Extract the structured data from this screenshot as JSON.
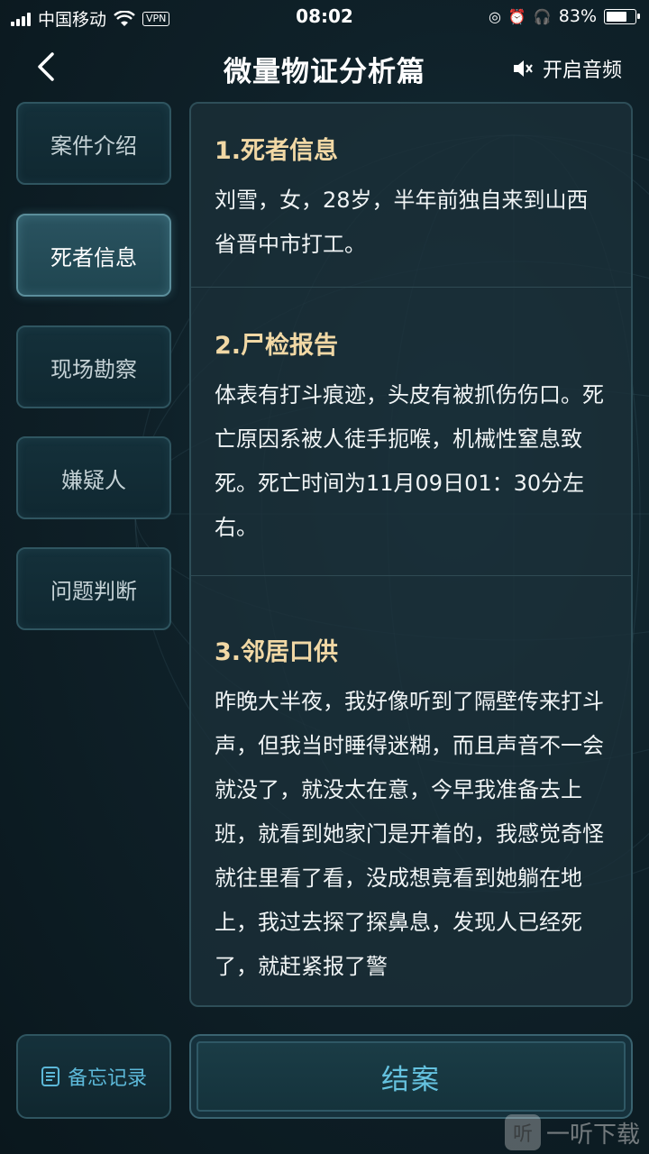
{
  "status_bar": {
    "carrier": "中国移动",
    "vpn": "VPN",
    "time": "08:02",
    "battery": "83%",
    "battery_level": 0.83
  },
  "header": {
    "title": "微量物证分析篇",
    "audio_label": "开启音频"
  },
  "sidebar": {
    "items": [
      {
        "label": "案件介绍",
        "active": false
      },
      {
        "label": "死者信息",
        "active": true
      },
      {
        "label": "现场勘察",
        "active": false
      },
      {
        "label": "嫌疑人",
        "active": false
      },
      {
        "label": "问题判断",
        "active": false
      }
    ]
  },
  "sections": [
    {
      "title": "1.死者信息",
      "body": "刘雪，女，28岁，半年前独自来到山西省晋中市打工。"
    },
    {
      "title": "2.尸检报告",
      "body": "体表有打斗痕迹，头皮有被抓伤伤口。死亡原因系被人徒手扼喉，机械性窒息致死。死亡时间为11月09日01：30分左右。"
    },
    {
      "title": "3.邻居口供",
      "body": "昨晚大半夜，我好像听到了隔壁传来打斗声，但我当时睡得迷糊，而且声音不一会就没了，就没太在意，今早我准备去上班，就看到她家门是开着的，我感觉奇怪就往里看了看，没成想竟看到她躺在地上，我过去探了探鼻息，发现人已经死了，就赶紧报了警"
    }
  ],
  "bottom": {
    "memo_label": "备忘记录",
    "close_case_label": "结案"
  },
  "watermark": "一听下载"
}
